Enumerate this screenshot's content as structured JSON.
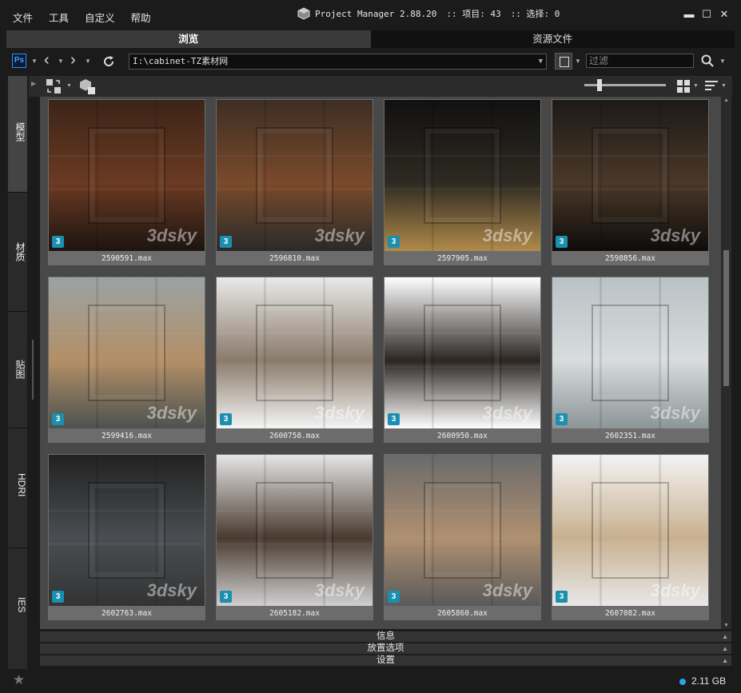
{
  "menu": [
    "文件",
    "工具",
    "自定义",
    "帮助"
  ],
  "title": {
    "app": "Project Manager 2.88.20",
    "items_label": ":: 项目: 43",
    "selected_label": ":: 选择: 0"
  },
  "tabs": [
    {
      "label": "浏览",
      "active": true
    },
    {
      "label": "资源文件",
      "active": false
    }
  ],
  "toolbar": {
    "path": "I:\\cabinet-TZ素材网",
    "filter_placeholder": "过滤",
    "ps_label": "Ps"
  },
  "sidebar": [
    {
      "label": "模型",
      "active": true
    },
    {
      "label": "材质",
      "active": false
    },
    {
      "label": "贴图",
      "active": false
    },
    {
      "label": "HDRI",
      "active": false
    },
    {
      "label": "IES",
      "active": false
    }
  ],
  "items": [
    {
      "name": "2590591.max",
      "colors": [
        "#3b2418",
        "#6b3a22",
        "#1c1410"
      ]
    },
    {
      "name": "2596810.max",
      "colors": [
        "#3d2e24",
        "#7a4a2a",
        "#2a2a2a"
      ]
    },
    {
      "name": "2597905.max",
      "colors": [
        "#111111",
        "#2e2a22",
        "#b08a4a"
      ]
    },
    {
      "name": "2598856.max",
      "colors": [
        "#1d1a18",
        "#4a3828",
        "#0e0c0b"
      ]
    },
    {
      "name": "2599416.max",
      "colors": [
        "#9aa3a3",
        "#b38f66",
        "#4c5250"
      ]
    },
    {
      "name": "2600758.max",
      "colors": [
        "#e9e9e9",
        "#8a7a6a",
        "#f5f5f5"
      ]
    },
    {
      "name": "2600950.max",
      "colors": [
        "#ffffff",
        "#2b2622",
        "#ffffff"
      ]
    },
    {
      "name": "2602351.max",
      "colors": [
        "#b9c2c5",
        "#d8dcdd",
        "#8c9598"
      ]
    },
    {
      "name": "2602763.max",
      "colors": [
        "#222222",
        "#4a4e52",
        "#333333"
      ]
    },
    {
      "name": "2605182.max",
      "colors": [
        "#e6e6e6",
        "#4a3a30",
        "#d0d0d0"
      ]
    },
    {
      "name": "2605860.max",
      "colors": [
        "#6a6a6a",
        "#b09070",
        "#5a5a5a"
      ]
    },
    {
      "name": "2607082.max",
      "colors": [
        "#f3f3f3",
        "#c8b090",
        "#e8e8e8"
      ]
    }
  ],
  "badge_label": "3",
  "watermark": "3dsky",
  "panels": [
    "信息",
    "放置选项",
    "设置"
  ],
  "status": {
    "disk": "2.11 GB"
  }
}
